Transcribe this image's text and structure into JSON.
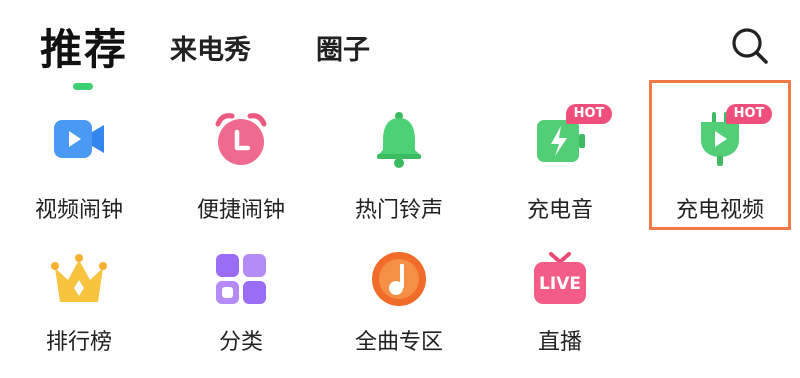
{
  "tabs": [
    {
      "label": "推荐",
      "active": true
    },
    {
      "label": "来电秀",
      "active": false
    },
    {
      "label": "圈子",
      "active": false
    }
  ],
  "icons": {
    "search": "search-icon"
  },
  "colors": {
    "accent": "#3ecf72",
    "hot": "#ef4f7a",
    "highlight": "#f07a45"
  },
  "grid": {
    "row1": [
      {
        "label": "视频闹钟",
        "icon": "video-camera-icon"
      },
      {
        "label": "便捷闹钟",
        "icon": "alarm-clock-icon"
      },
      {
        "label": "热门铃声",
        "icon": "bell-icon"
      },
      {
        "label": "充电音",
        "icon": "charging-battery-icon",
        "badge": "HOT"
      },
      {
        "label": "充电视频",
        "icon": "charging-video-icon",
        "badge": "HOT"
      }
    ],
    "row2": [
      {
        "label": "排行榜",
        "icon": "crown-icon"
      },
      {
        "label": "分类",
        "icon": "category-grid-icon"
      },
      {
        "label": "全曲专区",
        "icon": "music-note-icon"
      },
      {
        "label": "直播",
        "icon": "live-tv-icon",
        "badge": "LIVE"
      }
    ]
  }
}
